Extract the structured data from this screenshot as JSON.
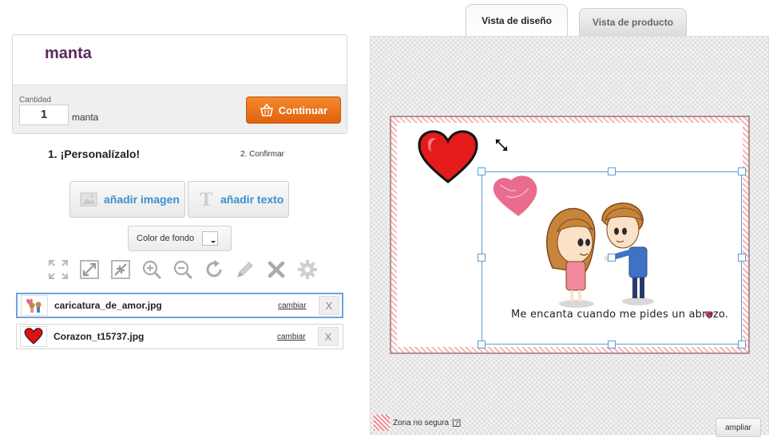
{
  "product": {
    "name": "manta",
    "quantity_label": "Cantidad",
    "quantity_value": "1",
    "quantity_unit": "manta",
    "continue_label": "Continuar"
  },
  "steps": {
    "step1": "1. ¡Personalízalo!",
    "step2": "2. Confirmar"
  },
  "actions": {
    "add_image": "añadir imagen",
    "add_text": "añadir texto",
    "background_color": "Color de fondo"
  },
  "layers": [
    {
      "name": "caricatura_de_amor.jpg",
      "change": "cambiar",
      "remove": "X"
    },
    {
      "name": "Corazon_t15737.jpg",
      "change": "cambiar",
      "remove": "X"
    }
  ],
  "tabs": {
    "design": "Vista de diseño",
    "product": "Vista de producto"
  },
  "canvas": {
    "caption": "Me encanta cuando me pides un abrazo.",
    "unsafe_zone": "Zona no segura",
    "unsafe_help": "[?]",
    "zoom": "ampliar"
  },
  "colors": {
    "accent_orange": "#e86f1a",
    "link_blue": "#3b8fd0",
    "title_purple": "#5a2a5a",
    "selection_blue": "#5a9bd6"
  }
}
